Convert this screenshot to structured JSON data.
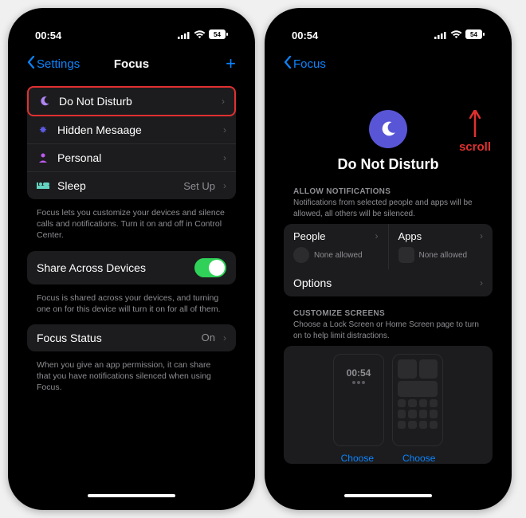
{
  "status": {
    "time": "00:54",
    "battery": "54"
  },
  "left": {
    "back": "Settings",
    "title": "Focus",
    "add": "+",
    "modes": [
      {
        "icon": "moon",
        "color": "#b084f5",
        "label": "Do Not Disturb",
        "trail": ""
      },
      {
        "icon": "paw",
        "color": "#5e5ce6",
        "label": "Hidden Mesaage",
        "trail": ""
      },
      {
        "icon": "person",
        "color": "#bf5af2",
        "label": "Personal",
        "trail": ""
      },
      {
        "icon": "bed",
        "color": "#64d2c1",
        "label": "Sleep",
        "trail": "Set Up"
      }
    ],
    "modes_footer": "Focus lets you customize your devices and silence calls and notifications. Turn it on and off in Control Center.",
    "share": {
      "label": "Share Across Devices"
    },
    "share_footer": "Focus is shared across your devices, and turning one on for this device will turn it on for all of them.",
    "status_row": {
      "label": "Focus Status",
      "value": "On"
    },
    "status_footer": "When you give an app permission, it can share that you have notifications silenced when using Focus."
  },
  "right": {
    "back": "Focus",
    "hero": "Do Not Disturb",
    "annot": "scroll",
    "allow": {
      "header": "ALLOW NOTIFICATIONS",
      "sub": "Notifications from selected people and apps will be allowed, all others will be silenced.",
      "people": "People",
      "apps": "Apps",
      "none": "None allowed",
      "options": "Options"
    },
    "screens": {
      "header": "CUSTOMIZE SCREENS",
      "sub": "Choose a Lock Screen or Home Screen page to turn on to help limit distractions.",
      "lock_time": "00:54",
      "choose": "Choose"
    }
  }
}
